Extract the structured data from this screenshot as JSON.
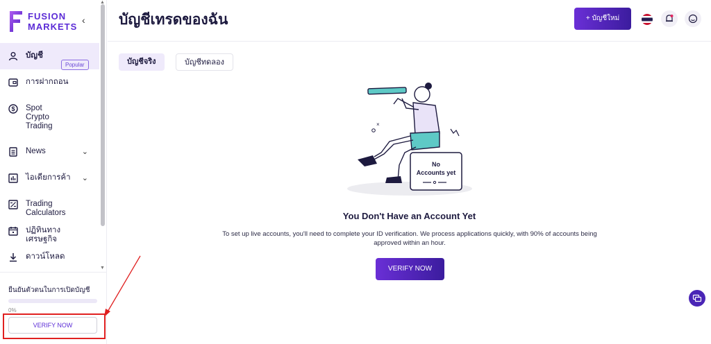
{
  "brand": {
    "line1": "FUSION",
    "line2": "MARKETS",
    "accent": "#5b2bd6"
  },
  "sidebar": {
    "items": [
      {
        "label": "บัญชี",
        "icon": "user-icon"
      },
      {
        "label": "การฝากถอน",
        "icon": "wallet-icon"
      },
      {
        "label": "Spot Crypto Trading",
        "icon": "dollar-icon",
        "badge": "Popular"
      },
      {
        "label": "News",
        "icon": "news-icon"
      },
      {
        "label": "ไอเดียการค้า",
        "icon": "chart-icon"
      },
      {
        "label": "Trading Calculators",
        "icon": "calculator-icon"
      },
      {
        "label": "ปฏิทินทางเศรษฐกิจ",
        "icon": "calendar-icon"
      },
      {
        "label": "ดาวน์โหลด",
        "icon": "download-icon"
      }
    ],
    "verify": {
      "title": "ยืนยันตัวตนในการเปิดบัญชี",
      "progress": 0,
      "progress_label": "0%",
      "button": "VERIFY NOW"
    }
  },
  "header": {
    "title": "บัญชีเทรดของฉัน",
    "new_account": "+ บัญชีใหม่"
  },
  "tabs": [
    "บัญชีจริง",
    "บัญชีทดลอง"
  ],
  "empty": {
    "illustration_label_1": "No",
    "illustration_label_2": "Accounts yet",
    "title": "You Don't Have an Account Yet",
    "description": "To set up live accounts, you'll need to complete your ID verification. We process applications quickly, with 90% of accounts being approved within an hour.",
    "button": "VERIFY NOW"
  }
}
